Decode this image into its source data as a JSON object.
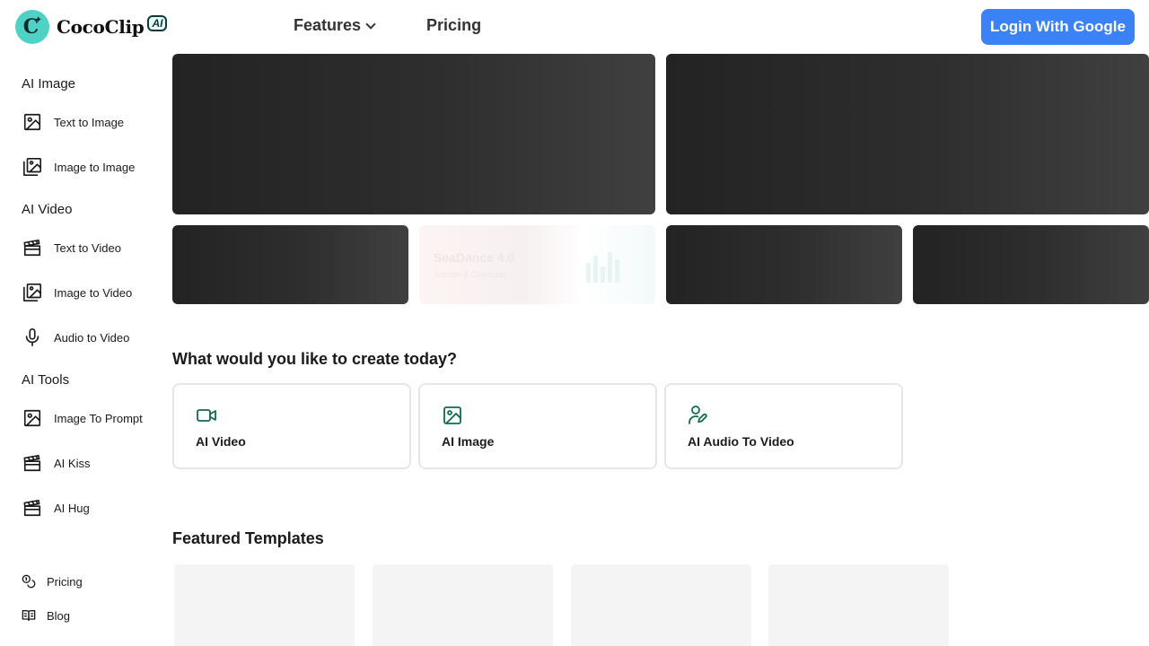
{
  "header": {
    "logo_text": "CocoClip",
    "logo_badge": "AI",
    "logo_mark": "C",
    "nav": {
      "features_label": "Features",
      "pricing_label": "Pricing"
    },
    "login_label": "Login With Google"
  },
  "sidebar": {
    "sections": [
      {
        "title": "AI Image",
        "items": [
          {
            "label": "Text to Image",
            "icon": "image-icon"
          },
          {
            "label": "Image to Image",
            "icon": "images-icon"
          }
        ]
      },
      {
        "title": "AI Video",
        "items": [
          {
            "label": "Text to Video",
            "icon": "clapperboard-icon"
          },
          {
            "label": "Image to Video",
            "icon": "images-icon"
          },
          {
            "label": "Audio to Video",
            "icon": "microphone-icon"
          }
        ]
      },
      {
        "title": "AI Tools",
        "items": [
          {
            "label": "Image To Prompt",
            "icon": "image-icon"
          },
          {
            "label": "AI Kiss",
            "icon": "clapperboard-icon"
          },
          {
            "label": "AI Hug",
            "icon": "clapperboard-icon"
          }
        ]
      }
    ],
    "footer": [
      {
        "label": "Pricing",
        "icon": "coins-icon"
      },
      {
        "label": "Blog",
        "icon": "book-icon"
      }
    ]
  },
  "banners": {
    "faded_title": "SeaDance 4.0",
    "faded_subtitle": "Smooth & Cinematic"
  },
  "create": {
    "title": "What would you like to create today?",
    "cards": [
      {
        "label": "AI Video",
        "icon": "video-camera-icon"
      },
      {
        "label": "AI Image",
        "icon": "image-icon"
      },
      {
        "label": "AI Audio To Video",
        "icon": "user-pen-icon"
      }
    ]
  },
  "templates": {
    "title": "Featured Templates"
  },
  "colors": {
    "accent": "#3b82f6",
    "brand_teal": "#4fd1c5",
    "icon_green": "#0f6b4d"
  }
}
